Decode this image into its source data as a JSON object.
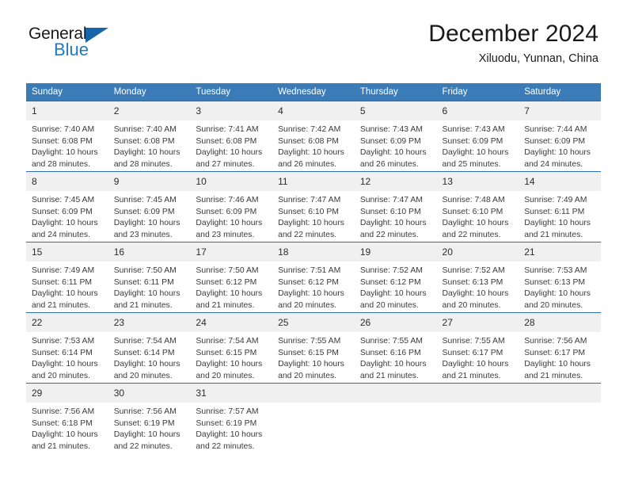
{
  "brand": {
    "name_top": "General",
    "name_bottom": "Blue",
    "triangle_color": "#1565a8",
    "blue_color": "#1f7ac4"
  },
  "header": {
    "title": "December 2024",
    "location": "Xiluodu, Yunnan, China"
  },
  "theme": {
    "header_blue": "#3b7cb8",
    "cell_top_border": "#2f6da8",
    "daynum_band": "#f0f0f0",
    "text": "#3a3a3a"
  },
  "weekdays": [
    "Sunday",
    "Monday",
    "Tuesday",
    "Wednesday",
    "Thursday",
    "Friday",
    "Saturday"
  ],
  "weeks": [
    [
      {
        "day": "1",
        "sunrise": "Sunrise: 7:40 AM",
        "sunset": "Sunset: 6:08 PM",
        "daylight1": "Daylight: 10 hours",
        "daylight2": "and 28 minutes."
      },
      {
        "day": "2",
        "sunrise": "Sunrise: 7:40 AM",
        "sunset": "Sunset: 6:08 PM",
        "daylight1": "Daylight: 10 hours",
        "daylight2": "and 28 minutes."
      },
      {
        "day": "3",
        "sunrise": "Sunrise: 7:41 AM",
        "sunset": "Sunset: 6:08 PM",
        "daylight1": "Daylight: 10 hours",
        "daylight2": "and 27 minutes."
      },
      {
        "day": "4",
        "sunrise": "Sunrise: 7:42 AM",
        "sunset": "Sunset: 6:08 PM",
        "daylight1": "Daylight: 10 hours",
        "daylight2": "and 26 minutes."
      },
      {
        "day": "5",
        "sunrise": "Sunrise: 7:43 AM",
        "sunset": "Sunset: 6:09 PM",
        "daylight1": "Daylight: 10 hours",
        "daylight2": "and 26 minutes."
      },
      {
        "day": "6",
        "sunrise": "Sunrise: 7:43 AM",
        "sunset": "Sunset: 6:09 PM",
        "daylight1": "Daylight: 10 hours",
        "daylight2": "and 25 minutes."
      },
      {
        "day": "7",
        "sunrise": "Sunrise: 7:44 AM",
        "sunset": "Sunset: 6:09 PM",
        "daylight1": "Daylight: 10 hours",
        "daylight2": "and 24 minutes."
      }
    ],
    [
      {
        "day": "8",
        "sunrise": "Sunrise: 7:45 AM",
        "sunset": "Sunset: 6:09 PM",
        "daylight1": "Daylight: 10 hours",
        "daylight2": "and 24 minutes."
      },
      {
        "day": "9",
        "sunrise": "Sunrise: 7:45 AM",
        "sunset": "Sunset: 6:09 PM",
        "daylight1": "Daylight: 10 hours",
        "daylight2": "and 23 minutes."
      },
      {
        "day": "10",
        "sunrise": "Sunrise: 7:46 AM",
        "sunset": "Sunset: 6:09 PM",
        "daylight1": "Daylight: 10 hours",
        "daylight2": "and 23 minutes."
      },
      {
        "day": "11",
        "sunrise": "Sunrise: 7:47 AM",
        "sunset": "Sunset: 6:10 PM",
        "daylight1": "Daylight: 10 hours",
        "daylight2": "and 22 minutes."
      },
      {
        "day": "12",
        "sunrise": "Sunrise: 7:47 AM",
        "sunset": "Sunset: 6:10 PM",
        "daylight1": "Daylight: 10 hours",
        "daylight2": "and 22 minutes."
      },
      {
        "day": "13",
        "sunrise": "Sunrise: 7:48 AM",
        "sunset": "Sunset: 6:10 PM",
        "daylight1": "Daylight: 10 hours",
        "daylight2": "and 22 minutes."
      },
      {
        "day": "14",
        "sunrise": "Sunrise: 7:49 AM",
        "sunset": "Sunset: 6:11 PM",
        "daylight1": "Daylight: 10 hours",
        "daylight2": "and 21 minutes."
      }
    ],
    [
      {
        "day": "15",
        "sunrise": "Sunrise: 7:49 AM",
        "sunset": "Sunset: 6:11 PM",
        "daylight1": "Daylight: 10 hours",
        "daylight2": "and 21 minutes."
      },
      {
        "day": "16",
        "sunrise": "Sunrise: 7:50 AM",
        "sunset": "Sunset: 6:11 PM",
        "daylight1": "Daylight: 10 hours",
        "daylight2": "and 21 minutes."
      },
      {
        "day": "17",
        "sunrise": "Sunrise: 7:50 AM",
        "sunset": "Sunset: 6:12 PM",
        "daylight1": "Daylight: 10 hours",
        "daylight2": "and 21 minutes."
      },
      {
        "day": "18",
        "sunrise": "Sunrise: 7:51 AM",
        "sunset": "Sunset: 6:12 PM",
        "daylight1": "Daylight: 10 hours",
        "daylight2": "and 20 minutes."
      },
      {
        "day": "19",
        "sunrise": "Sunrise: 7:52 AM",
        "sunset": "Sunset: 6:12 PM",
        "daylight1": "Daylight: 10 hours",
        "daylight2": "and 20 minutes."
      },
      {
        "day": "20",
        "sunrise": "Sunrise: 7:52 AM",
        "sunset": "Sunset: 6:13 PM",
        "daylight1": "Daylight: 10 hours",
        "daylight2": "and 20 minutes."
      },
      {
        "day": "21",
        "sunrise": "Sunrise: 7:53 AM",
        "sunset": "Sunset: 6:13 PM",
        "daylight1": "Daylight: 10 hours",
        "daylight2": "and 20 minutes."
      }
    ],
    [
      {
        "day": "22",
        "sunrise": "Sunrise: 7:53 AM",
        "sunset": "Sunset: 6:14 PM",
        "daylight1": "Daylight: 10 hours",
        "daylight2": "and 20 minutes."
      },
      {
        "day": "23",
        "sunrise": "Sunrise: 7:54 AM",
        "sunset": "Sunset: 6:14 PM",
        "daylight1": "Daylight: 10 hours",
        "daylight2": "and 20 minutes."
      },
      {
        "day": "24",
        "sunrise": "Sunrise: 7:54 AM",
        "sunset": "Sunset: 6:15 PM",
        "daylight1": "Daylight: 10 hours",
        "daylight2": "and 20 minutes."
      },
      {
        "day": "25",
        "sunrise": "Sunrise: 7:55 AM",
        "sunset": "Sunset: 6:15 PM",
        "daylight1": "Daylight: 10 hours",
        "daylight2": "and 20 minutes."
      },
      {
        "day": "26",
        "sunrise": "Sunrise: 7:55 AM",
        "sunset": "Sunset: 6:16 PM",
        "daylight1": "Daylight: 10 hours",
        "daylight2": "and 21 minutes."
      },
      {
        "day": "27",
        "sunrise": "Sunrise: 7:55 AM",
        "sunset": "Sunset: 6:17 PM",
        "daylight1": "Daylight: 10 hours",
        "daylight2": "and 21 minutes."
      },
      {
        "day": "28",
        "sunrise": "Sunrise: 7:56 AM",
        "sunset": "Sunset: 6:17 PM",
        "daylight1": "Daylight: 10 hours",
        "daylight2": "and 21 minutes."
      }
    ],
    [
      {
        "day": "29",
        "sunrise": "Sunrise: 7:56 AM",
        "sunset": "Sunset: 6:18 PM",
        "daylight1": "Daylight: 10 hours",
        "daylight2": "and 21 minutes."
      },
      {
        "day": "30",
        "sunrise": "Sunrise: 7:56 AM",
        "sunset": "Sunset: 6:19 PM",
        "daylight1": "Daylight: 10 hours",
        "daylight2": "and 22 minutes."
      },
      {
        "day": "31",
        "sunrise": "Sunrise: 7:57 AM",
        "sunset": "Sunset: 6:19 PM",
        "daylight1": "Daylight: 10 hours",
        "daylight2": "and 22 minutes."
      },
      {
        "day": "",
        "sunrise": "",
        "sunset": "",
        "daylight1": "",
        "daylight2": ""
      },
      {
        "day": "",
        "sunrise": "",
        "sunset": "",
        "daylight1": "",
        "daylight2": ""
      },
      {
        "day": "",
        "sunrise": "",
        "sunset": "",
        "daylight1": "",
        "daylight2": ""
      },
      {
        "day": "",
        "sunrise": "",
        "sunset": "",
        "daylight1": "",
        "daylight2": ""
      }
    ]
  ]
}
